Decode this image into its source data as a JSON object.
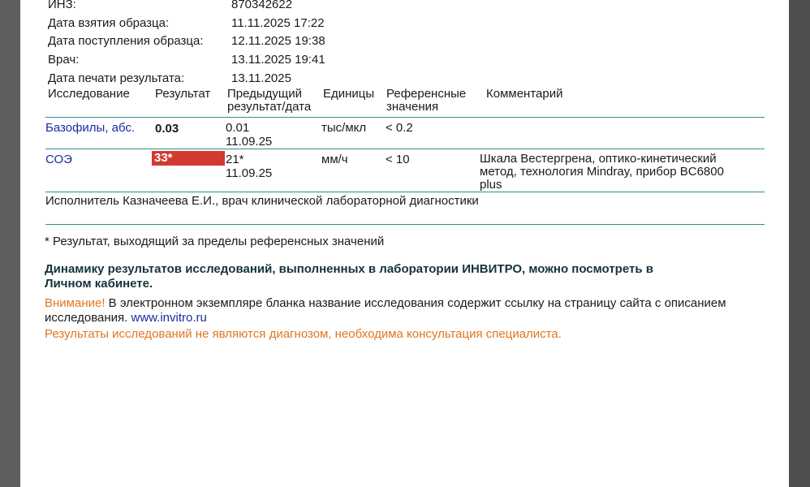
{
  "meta": [
    {
      "label": "ИНЗ:",
      "value": "870342622"
    },
    {
      "label": "Дата взятия образца:",
      "value": "11.11.2025 17:22"
    },
    {
      "label": "Дата поступления образца:",
      "value": "12.11.2025 19:38"
    },
    {
      "label": "Врач:",
      "value": "13.11.2025 19:41"
    },
    {
      "label": "Дата печати результата:",
      "value": "13.11.2025"
    }
  ],
  "table": {
    "headers": {
      "test": "Исследование",
      "result": "Результат",
      "previous_line1": "Предыдущий",
      "previous_line2": "результат/дата",
      "units": "Единицы",
      "reference_line1": "Референсные",
      "reference_line2": "значения",
      "comment": "Комментарий"
    },
    "rows": [
      {
        "test": "Базофилы, абс.",
        "result": "0.03",
        "prev_value": "0.01",
        "prev_date": "11.09.25",
        "units": "тыс/мкл",
        "reference": "< 0.2",
        "comment_lines": [
          "",
          "",
          ""
        ]
      },
      {
        "test": "СОЭ",
        "result": "33*",
        "prev_value": "21*",
        "prev_date": "11.09.25",
        "units": "мм/ч",
        "reference": "< 10",
        "comment_lines": [
          "Шкала Вестергрена, оптико-кинетический",
          "метод, технология Mindray, прибор BC6800",
          "plus"
        ]
      }
    ]
  },
  "performer": "Исполнитель Казначеева  Е.И., врач клинической лабораторной диагностики",
  "footnote": "* Результат, выходящий за пределы референсных значений",
  "dynamics_line1": "Динамику результатов исследований, выполненных в лаборатории ИНВИТРО, можно посмотреть в",
  "dynamics_line2": "Личном кабинете.",
  "attention_label": "Внимание!",
  "attention_text": " В электронном экземпляре бланка название исследования содержит ссылку на страницу сайта с описанием",
  "attention_text2": "исследования. ",
  "site_link": "www.invitro.ru",
  "disclaimer": "Результаты исследований не являются диагнозом, необходима консультация специалиста.",
  "colors": {
    "accent_line": "#2f8f8c",
    "flag_bg": "#d03a30",
    "link": "#1e2aa0",
    "warning": "#e0761f"
  }
}
